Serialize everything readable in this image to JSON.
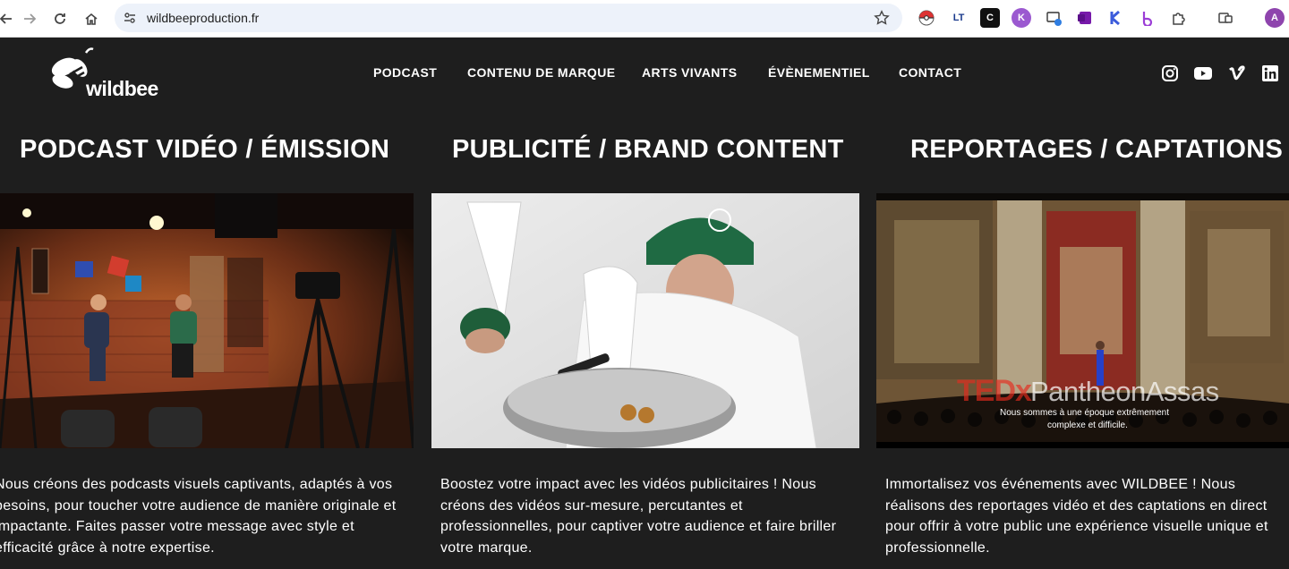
{
  "browser": {
    "url": "wildbeeproduction.fr",
    "profile_initial": "A",
    "ext_lt": "LT",
    "ext_c": "C",
    "ext_k": "K"
  },
  "logo": {
    "text": "wildbee"
  },
  "nav": {
    "items": [
      "PODCAST",
      "CONTENU DE MARQUE",
      "ARTS VIVANTS",
      "ÉVÈNEMENTIEL",
      "CONTACT"
    ]
  },
  "columns": [
    {
      "title": "PODCAST VIDÉO / ÉMISSION",
      "text": "Nous créons des podcasts visuels captivants, adaptés à vos besoins, pour toucher votre audience de manière originale et impactante. Faites passer votre message avec style et efficacité grâce à notre expertise."
    },
    {
      "title": "PUBLICITÉ / BRAND CONTENT",
      "text": "Boostez votre impact avec les vidéos publicitaires ! Nous créons des vidéos sur-mesure, percutantes et professionnelles, pour captiver votre audience et faire briller votre marque."
    },
    {
      "title": "REPORTAGES / CAPTATIONS",
      "text": "Immortalisez vos événements avec WILDBEE ! Nous réalisons des reportages vidéo et des captations en direct pour offrir à votre public une expérience visuelle unique et professionnelle.",
      "overlay_brand": "TEDx",
      "overlay_name": "PantheonAssas",
      "overlay_subtitle_1": "Nous sommes à une époque extrêmement",
      "overlay_subtitle_2": "complexe et difficile."
    }
  ],
  "colors": {
    "page_bg": "#1e1e1e",
    "ted_red": "#e62b1e",
    "accent_purple": "#8e44ad"
  }
}
